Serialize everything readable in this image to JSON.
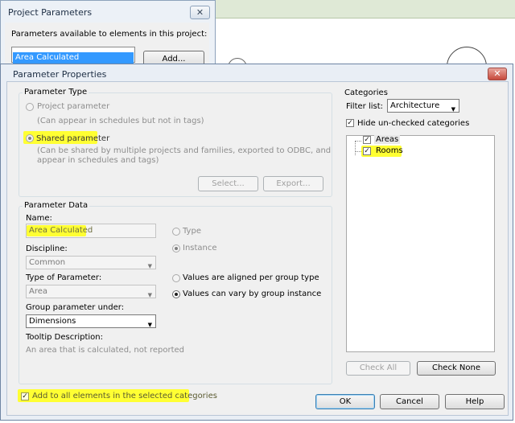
{
  "project_parameters": {
    "title": "Project Parameters",
    "close_glyph": "✕",
    "available_label": "Parameters available to elements in this project:",
    "selected_item": "Area Calculated",
    "add_label": "Add..."
  },
  "dialog": {
    "title": "Parameter Properties",
    "close_glyph": "✕",
    "parameter_type": {
      "legend": "Parameter Type",
      "project_option": "Project parameter",
      "project_hint": "(Can appear in schedules but not in tags)",
      "shared_option": "Shared parameter",
      "shared_hint_line1": "(Can be shared by multiple projects and families, exported to ODBC, and",
      "shared_hint_line2": "appear in schedules and tags)",
      "select_label": "Select...",
      "export_label": "Export..."
    },
    "parameter_data": {
      "legend": "Parameter Data",
      "name_label": "Name:",
      "name_value": "Area Calculated",
      "type_option": "Type",
      "instance_option": "Instance",
      "discipline_label": "Discipline:",
      "discipline_value": "Common",
      "type_of_parameter_label": "Type of Parameter:",
      "type_of_parameter_value": "Area",
      "aligned_option": "Values are aligned per group type",
      "vary_option": "Values can vary by group instance",
      "group_label": "Group parameter under:",
      "group_value": "Dimensions",
      "tooltip_label": "Tooltip Description:",
      "tooltip_value": "An area that is calculated, not reported"
    },
    "categories": {
      "legend": "Categories",
      "filter_label": "Filter list:",
      "filter_value": "Architecture",
      "hide_unchecked_label": "Hide un-checked categories",
      "items": [
        {
          "label": "Areas",
          "checked": true
        },
        {
          "label": "Rooms",
          "checked": true
        }
      ],
      "check_all_label": "Check All",
      "check_none_label": "Check None"
    },
    "add_to_all_label": "Add to all elements in the selected categories",
    "ok_label": "OK",
    "cancel_label": "Cancel",
    "help_label": "Help",
    "check_glyph": "✓",
    "arrow_glyph": "▼"
  },
  "colors": {
    "highlight": "#ffff33",
    "selection": "#3399ff"
  }
}
